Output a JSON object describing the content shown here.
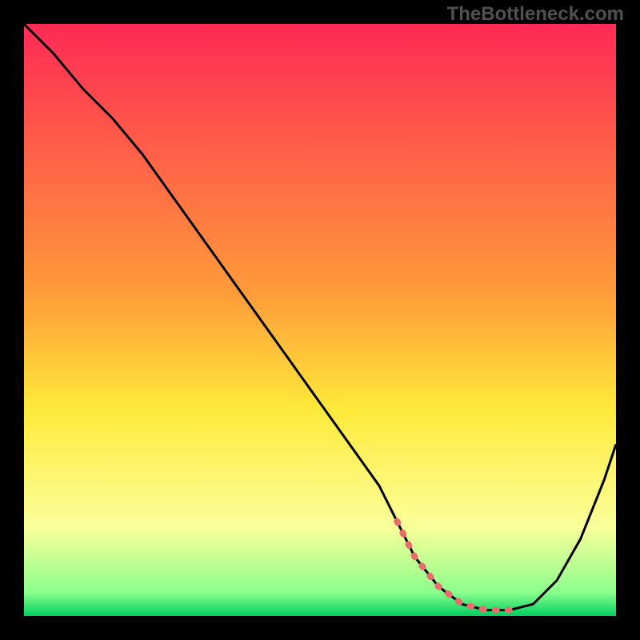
{
  "watermark": "TheBottleneck.com",
  "chart_data": {
    "type": "line",
    "title": "",
    "xlabel": "",
    "ylabel": "",
    "xlim": [
      0,
      100
    ],
    "ylim": [
      0,
      100
    ],
    "grid": false,
    "gradient_stops": [
      {
        "offset": 0,
        "color": "#ff2a55"
      },
      {
        "offset": 45,
        "color": "#ff9a3a"
      },
      {
        "offset": 65,
        "color": "#ffe93a"
      },
      {
        "offset": 85,
        "color": "#faff9a"
      },
      {
        "offset": 96,
        "color": "#8cff8c"
      },
      {
        "offset": 100,
        "color": "#00d060"
      }
    ],
    "series": [
      {
        "name": "curve",
        "x": [
          0,
          5,
          10,
          15,
          20,
          25,
          30,
          35,
          40,
          45,
          50,
          55,
          60,
          63,
          66,
          70,
          74,
          78,
          82,
          86,
          90,
          94,
          98,
          100
        ],
        "values": [
          100,
          95,
          89,
          84,
          78,
          71,
          64,
          57,
          50,
          43,
          36,
          29,
          22,
          16,
          10,
          5,
          2,
          1,
          1,
          2,
          6,
          13,
          23,
          29
        ]
      }
    ],
    "optimal_zone": {
      "x_start": 63,
      "x_end": 82
    }
  }
}
